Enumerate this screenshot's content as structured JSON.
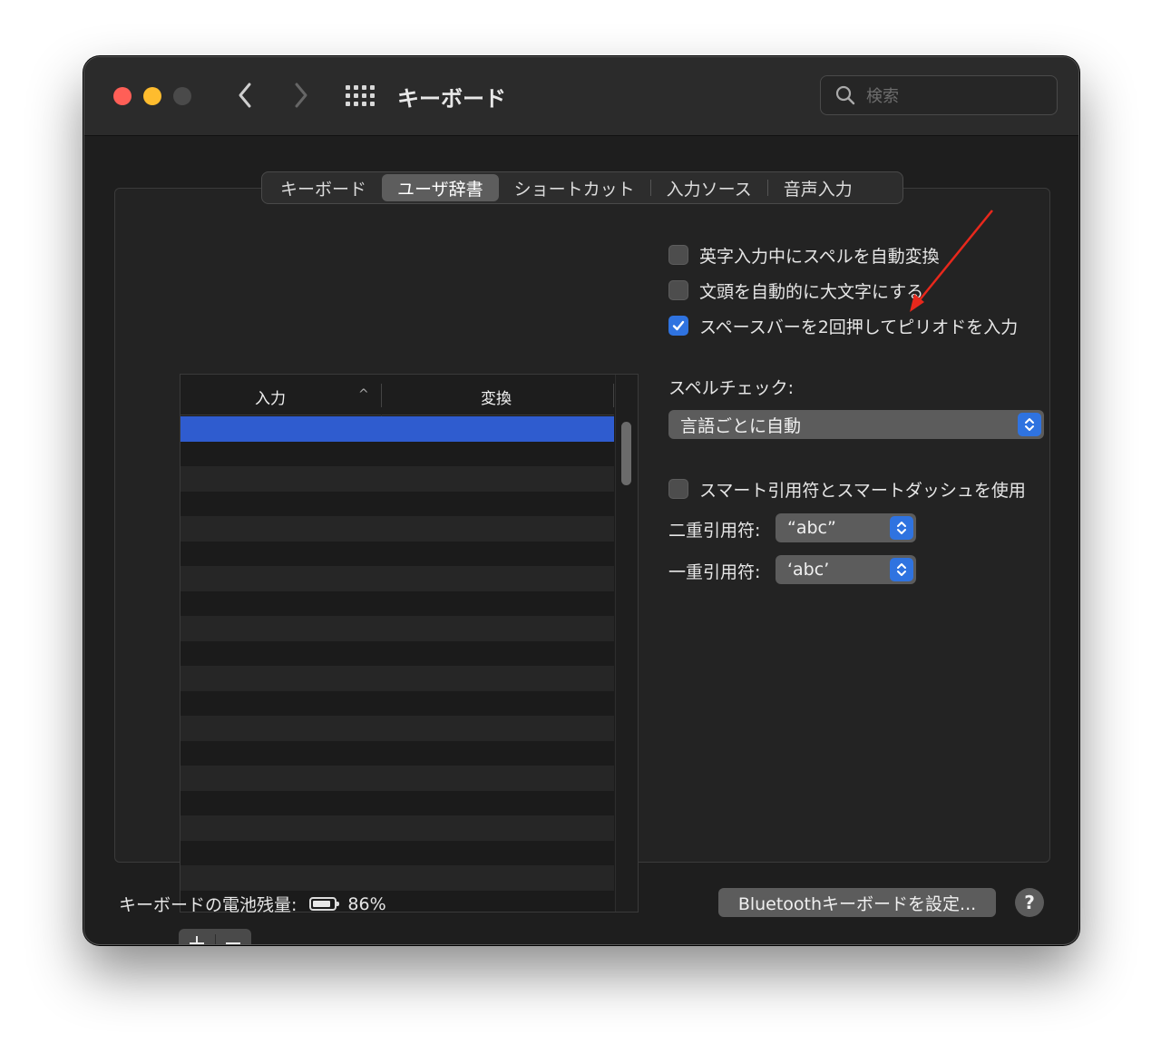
{
  "window": {
    "title": "キーボード"
  },
  "search": {
    "placeholder": "検索"
  },
  "tabs": [
    {
      "label": "キーボード"
    },
    {
      "label": "ユーザ辞書"
    },
    {
      "label": "ショートカット"
    },
    {
      "label": "入力ソース"
    },
    {
      "label": "音声入力"
    }
  ],
  "table": {
    "col_input": "入力",
    "col_conversion": "変換",
    "rows": [
      {
        "input": "",
        "conversion": ""
      },
      {
        "input": "",
        "conversion": ""
      },
      {
        "input": "",
        "conversion": ""
      },
      {
        "input": "",
        "conversion": ""
      },
      {
        "input": "",
        "conversion": ""
      },
      {
        "input": "",
        "conversion": ""
      },
      {
        "input": "",
        "conversion": ""
      },
      {
        "input": "",
        "conversion": ""
      },
      {
        "input": "",
        "conversion": ""
      },
      {
        "input": "",
        "conversion": ""
      },
      {
        "input": "",
        "conversion": ""
      },
      {
        "input": "",
        "conversion": ""
      },
      {
        "input": "",
        "conversion": ""
      },
      {
        "input": "",
        "conversion": ""
      },
      {
        "input": "",
        "conversion": ""
      },
      {
        "input": "",
        "conversion": ""
      },
      {
        "input": "",
        "conversion": ""
      },
      {
        "input": "",
        "conversion": ""
      },
      {
        "input": "",
        "conversion": ""
      },
      {
        "input": "",
        "conversion": ""
      }
    ]
  },
  "options": {
    "auto_correct_label": "英字入力中にスペルを自動変換",
    "auto_correct_checked": false,
    "capitalize_label": "文頭を自動的に大文字にする",
    "capitalize_checked": false,
    "period_label": "スペースバーを2回押してピリオドを入力",
    "period_checked": true,
    "spellcheck_label": "スペルチェック:",
    "spellcheck_value": "言語ごとに自動",
    "smart_quotes_label": "スマート引用符とスマートダッシュを使用",
    "smart_quotes_checked": false,
    "double_quote_label": "二重引用符:",
    "double_quote_value": "“abc”",
    "single_quote_label": "一重引用符:",
    "single_quote_value": "‘abc’"
  },
  "footer": {
    "battery_label": "キーボードの電池残量:",
    "battery_percent": "86%",
    "battery_level": 0.86,
    "bluetooth_button": "Bluetoothキーボードを設定...",
    "help_label": "?"
  },
  "colors": {
    "accent": "#2f73e0",
    "selection": "#2f5ccf",
    "annotation_arrow": "#e8281c"
  }
}
